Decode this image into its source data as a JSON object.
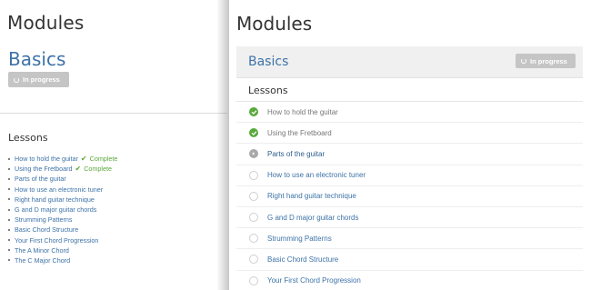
{
  "colors": {
    "link": "#3d72a8",
    "complete": "#5aa93c",
    "badge_bg": "#c5c5c5",
    "header_bg": "#f0f0f0"
  },
  "left": {
    "page_title": "Modules",
    "section_title": "Basics",
    "badge_label": "In progress",
    "lessons_heading": "Lessons",
    "complete_label": "Complete",
    "lessons": [
      {
        "title": "How to hold the guitar",
        "complete": true
      },
      {
        "title": "Using the Fretboard",
        "complete": true
      },
      {
        "title": "Parts of the guitar",
        "complete": false
      },
      {
        "title": "How to use an electronic tuner",
        "complete": false
      },
      {
        "title": "Right hand guitar technique",
        "complete": false
      },
      {
        "title": "G and D major guitar chords",
        "complete": false
      },
      {
        "title": "Strumming Patterns",
        "complete": false
      },
      {
        "title": "Basic Chord Structure",
        "complete": false
      },
      {
        "title": "Your First Chord Progression",
        "complete": false
      },
      {
        "title": "The A Minor Chord",
        "complete": false
      },
      {
        "title": "The C Major Chord",
        "complete": false
      }
    ]
  },
  "right": {
    "page_title": "Modules",
    "section_title": "Basics",
    "badge_label": "In progress",
    "lessons_heading": "Lessons",
    "lessons": [
      {
        "title": "How to hold the guitar",
        "state": "done",
        "icon": "check-circle-icon"
      },
      {
        "title": "Using the Fretboard",
        "state": "done",
        "icon": "check-circle-icon"
      },
      {
        "title": "Parts of the guitar",
        "state": "current",
        "icon": "arrow-circle-icon"
      },
      {
        "title": "How to use an electronic tuner",
        "state": "todo",
        "icon": "empty-circle-icon"
      },
      {
        "title": "Right hand guitar technique",
        "state": "todo",
        "icon": "empty-circle-icon"
      },
      {
        "title": "G and D major guitar chords",
        "state": "todo",
        "icon": "empty-circle-icon"
      },
      {
        "title": "Strumming Patterns",
        "state": "todo",
        "icon": "empty-circle-icon"
      },
      {
        "title": "Basic Chord Structure",
        "state": "todo",
        "icon": "empty-circle-icon"
      },
      {
        "title": "Your First Chord Progression",
        "state": "todo",
        "icon": "empty-circle-icon"
      }
    ]
  }
}
